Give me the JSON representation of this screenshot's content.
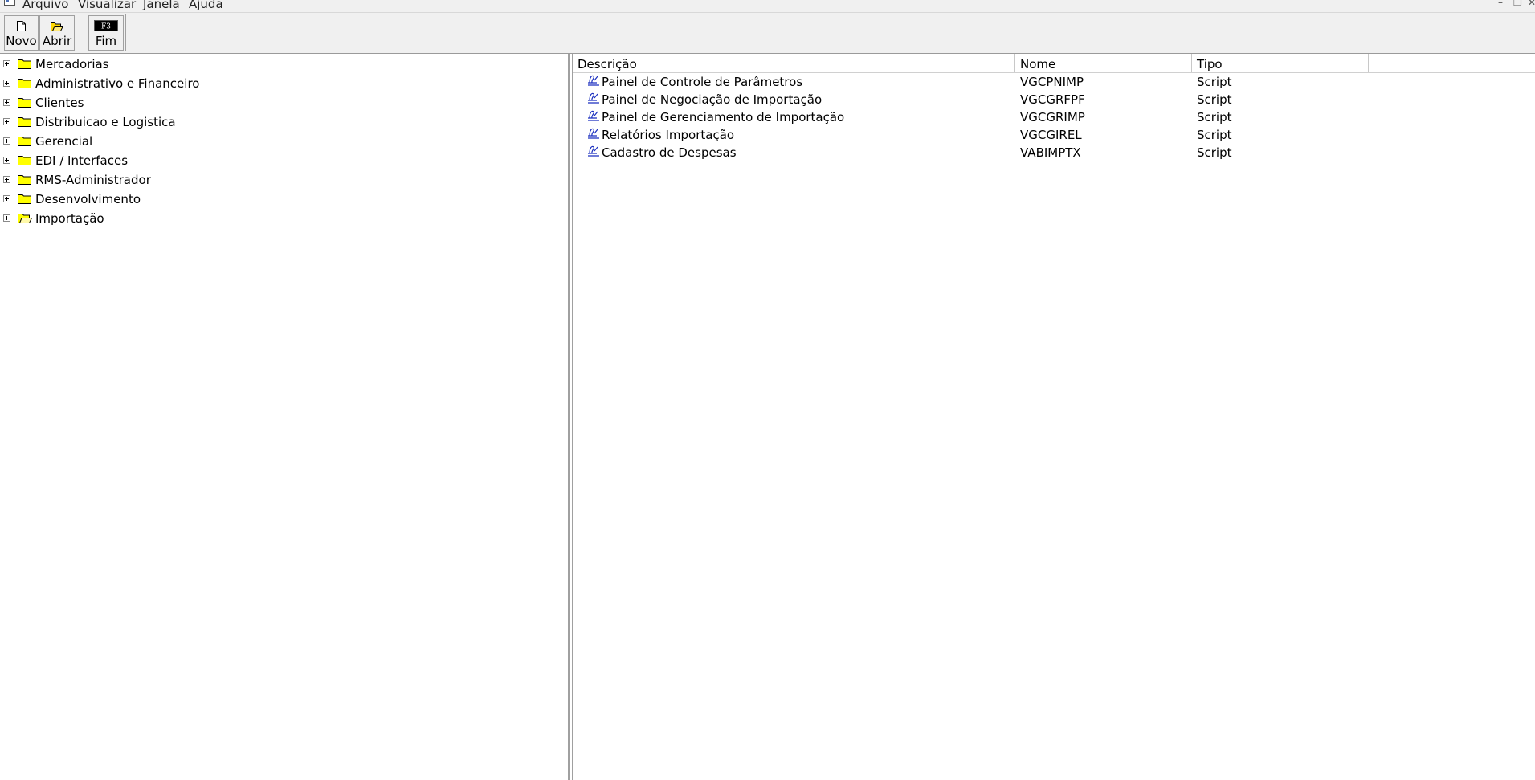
{
  "menu": {
    "items": [
      "Arquivo",
      "Visualizar",
      "Janela",
      "Ajuda"
    ]
  },
  "toolbar": {
    "buttons": [
      {
        "label": "Novo",
        "icon": "new-document-icon"
      },
      {
        "label": "Abrir",
        "icon": "open-folder-icon"
      },
      {
        "label": "Fim",
        "icon": "f3-key-icon",
        "key": "F3"
      }
    ]
  },
  "tree": {
    "items": [
      {
        "label": "Mercadorias",
        "state": "closed"
      },
      {
        "label": "Administrativo e Financeiro",
        "state": "closed"
      },
      {
        "label": "Clientes",
        "state": "closed"
      },
      {
        "label": "Distribuicao e Logistica",
        "state": "closed"
      },
      {
        "label": "Gerencial",
        "state": "closed"
      },
      {
        "label": "EDI / Interfaces",
        "state": "closed"
      },
      {
        "label": "RMS-Administrador",
        "state": "closed"
      },
      {
        "label": "Desenvolvimento",
        "state": "closed"
      },
      {
        "label": "Importação",
        "state": "open"
      }
    ]
  },
  "list": {
    "columns": [
      "Descrição",
      "Nome",
      "Tipo"
    ],
    "rows": [
      {
        "descricao": "Painel de Controle de Parâmetros",
        "nome": "VGCPNIMP",
        "tipo": "Script"
      },
      {
        "descricao": "Painel de Negociação de Importação",
        "nome": "VGCGRFPF",
        "tipo": "Script"
      },
      {
        "descricao": "Painel de Gerenciamento de Importação",
        "nome": "VGCGRIMP",
        "tipo": "Script"
      },
      {
        "descricao": "Relatórios Importação",
        "nome": "VGCGIREL",
        "tipo": "Script"
      },
      {
        "descricao": "Cadastro de Despesas",
        "nome": "VABIMPTX",
        "tipo": "Script"
      }
    ]
  },
  "colors": {
    "folder_yellow": "#ffff00",
    "script_icon_blue": "#1a2fbf",
    "chrome": "#f0f0f0"
  }
}
